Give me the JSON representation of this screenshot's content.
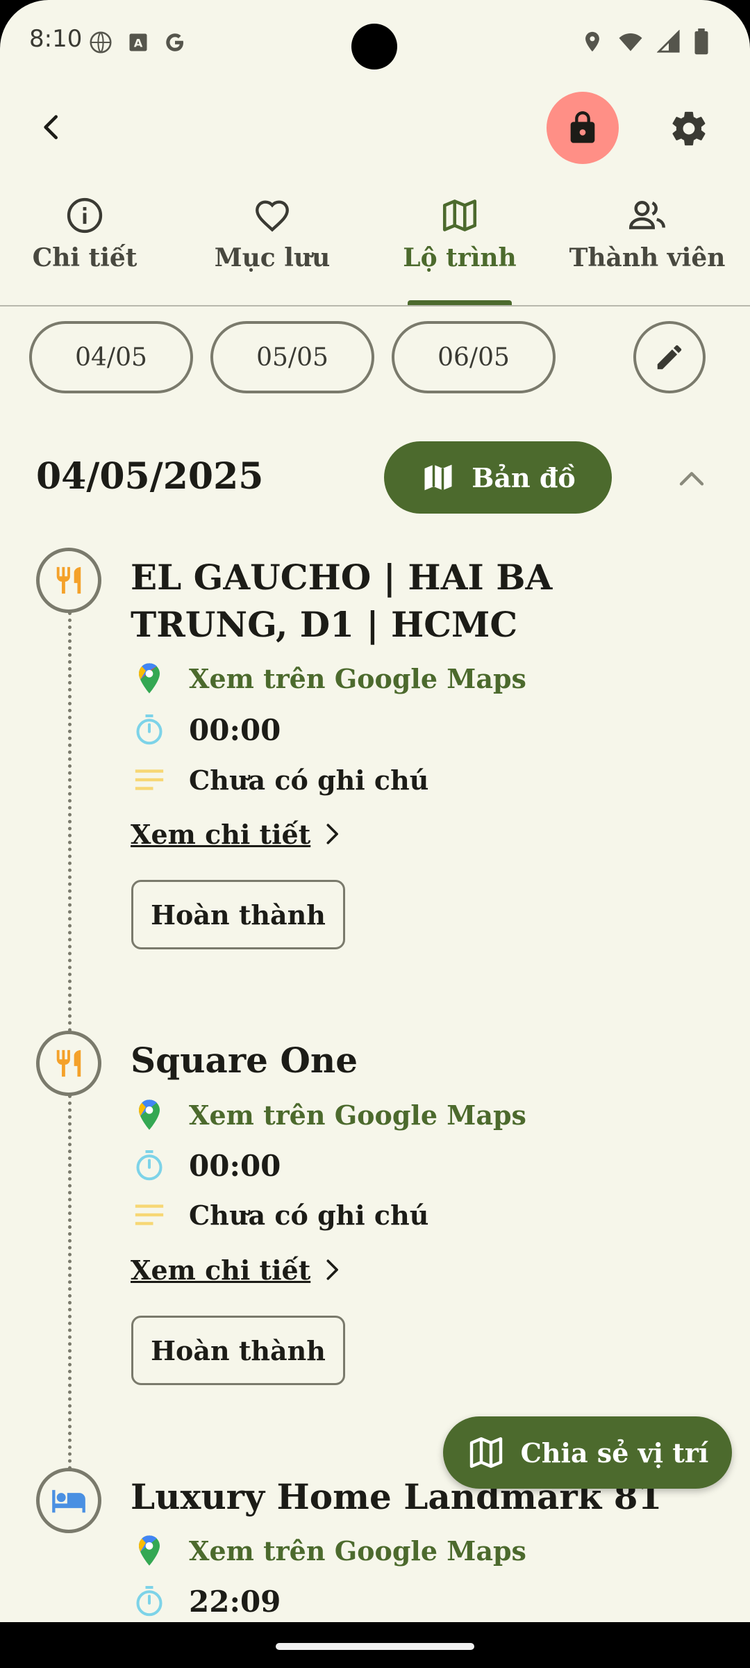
{
  "status_bar": {
    "time": "8:10"
  },
  "tabs": [
    {
      "label": "Chi tiết",
      "icon": "info-icon"
    },
    {
      "label": "Mục lưu",
      "icon": "heart-icon"
    },
    {
      "label": "Lộ trình",
      "icon": "map-icon",
      "active": true
    },
    {
      "label": "Thành viên",
      "icon": "people-icon"
    }
  ],
  "date_chips": [
    "04/05",
    "05/05",
    "06/05"
  ],
  "day": {
    "date": "04/05/2025",
    "map_button": "Bản đồ"
  },
  "stops": [
    {
      "title": "EL GAUCHO | HAI BA TRUNG, D1 | HCMC",
      "category_icon": "restaurant-icon",
      "maps_link": "Xem trên Google Maps",
      "time": "00:00",
      "note": "Chưa có ghi chú",
      "detail_link": "Xem chi tiết",
      "done_button": "Hoàn thành"
    },
    {
      "title": "Square One",
      "category_icon": "restaurant-icon",
      "maps_link": "Xem trên Google Maps",
      "time": "00:00",
      "note": "Chưa có ghi chú",
      "detail_link": "Xem chi tiết",
      "done_button": "Hoàn thành"
    },
    {
      "title": "Luxury Home Landmark 81",
      "category_icon": "bed-icon",
      "maps_link": "Xem trên Google Maps",
      "time": "22:09"
    }
  ],
  "fab": {
    "label": "Chia sẻ vị trí"
  },
  "colors": {
    "primary": "#4c6a2d",
    "lock_bg": "#ff8f86",
    "background": "#f6f6ea",
    "restaurant_icon": "#f4a12a",
    "bed_icon": "#4a90e2",
    "timer_icon": "#7dd3e8",
    "note_icon": "#f7d774"
  }
}
